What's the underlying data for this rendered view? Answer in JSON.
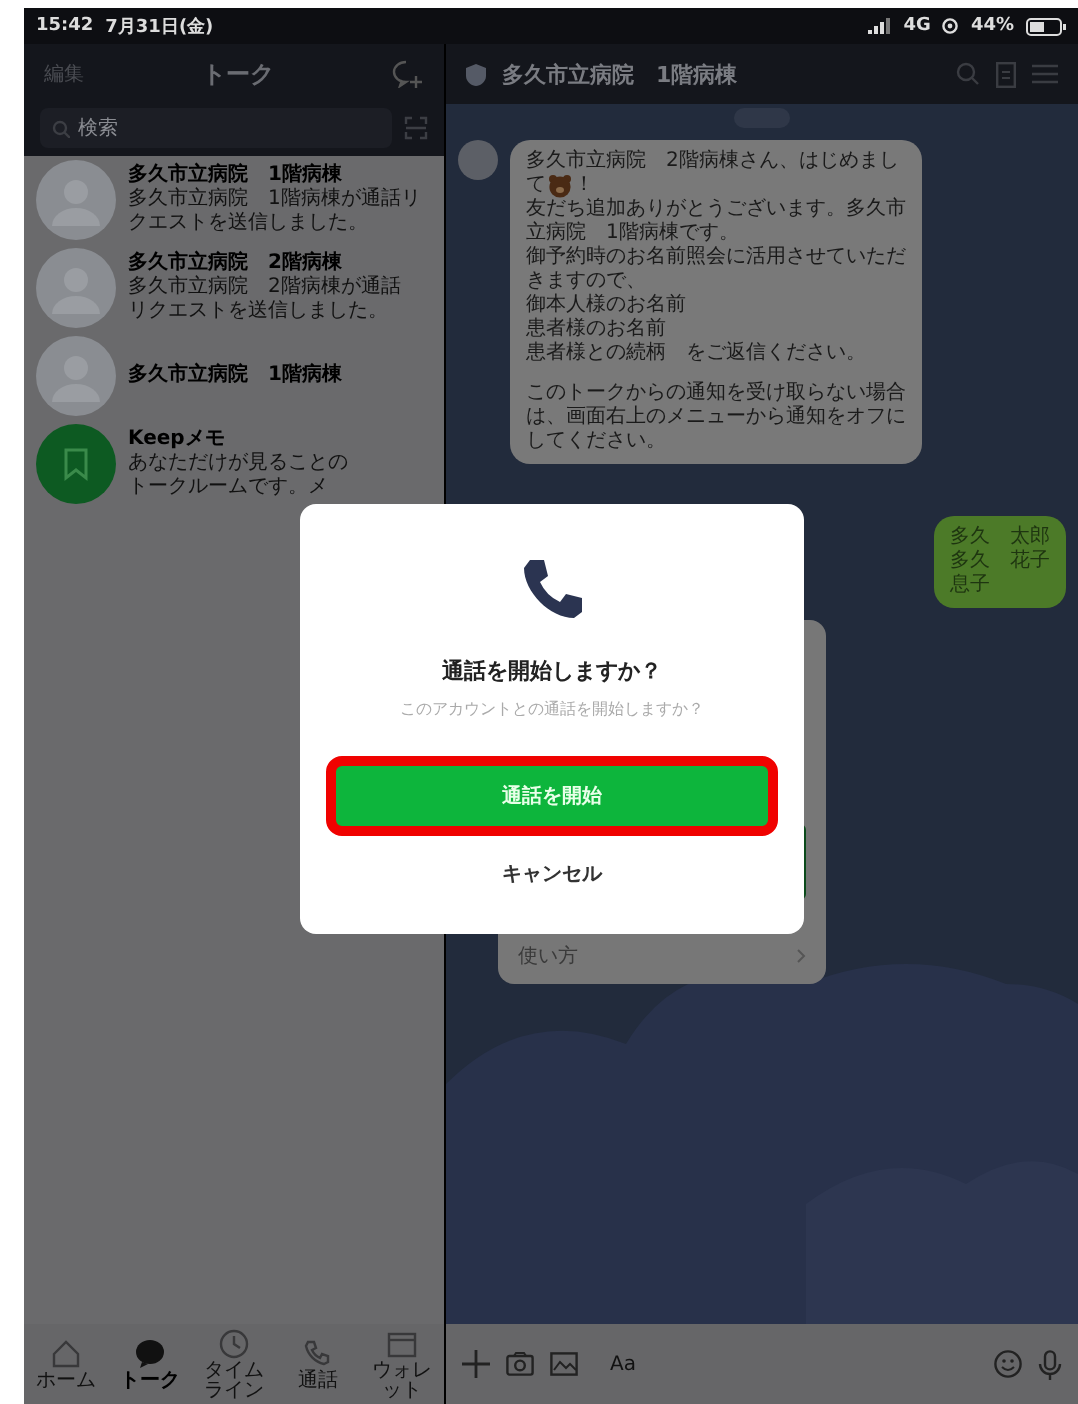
{
  "status_bar": {
    "time": "15:42",
    "date": "7月31日(金)",
    "network": "4G",
    "battery": "44%"
  },
  "sidebar": {
    "edit": "編集",
    "title": "トーク",
    "search_placeholder": "検索",
    "chats": [
      {
        "kind": "person",
        "name": "多久市立病院　1階病棟",
        "preview": [
          "多久市立病院　1階病棟が通話リ",
          "クエストを送信しました。"
        ]
      },
      {
        "kind": "person",
        "name": "多久市立病院　2階病棟",
        "preview": [
          "多久市立病院　2階病棟が通話",
          "リクエストを送信しました。"
        ]
      },
      {
        "kind": "person",
        "name": "多久市立病院　1階病棟"
      },
      {
        "kind": "keep",
        "name": "Keepメモ",
        "preview": [
          "あなただけが見ることの",
          "トークルームです。メ"
        ]
      }
    ]
  },
  "tabbar": [
    {
      "kind": "home",
      "label": "ホーム",
      "selected": false
    },
    {
      "kind": "talk",
      "label": "トーク",
      "selected": true
    },
    {
      "kind": "timeline",
      "label": "タイムライン",
      "selected": false
    },
    {
      "kind": "call",
      "label": "通話",
      "selected": false
    },
    {
      "kind": "wallet",
      "label": "ウォレット",
      "selected": false
    }
  ],
  "chat": {
    "title": "多久市立病院　1階病棟",
    "messages": [
      {
        "kind": "received",
        "paragraphs": [
          [
            "多久市立病院　2階病棟さん、はじめまし",
            [
              "て",
              {
                "kind": "emoji"
              },
              "！"
            ],
            "友だち追加ありがとうございます。多久市",
            "立病院　1階病棟です。",
            "御予約時のお名前照会に活用させていただ",
            "きますので、",
            "御本人様のお名前",
            "患者様のお名前",
            "患者様との続柄　をご返信ください。"
          ],
          [
            "このトークからの通知を受け取らない場合",
            "は、画面右上のメニューから通知をオフに",
            "してください。"
          ]
        ]
      },
      {
        "kind": "sent",
        "paragraphs": [
          [
            "多久　太郎",
            "多久　花子",
            "息子"
          ]
        ]
      },
      {
        "kind": "card",
        "link": "使い方"
      }
    ],
    "input_placeholder": "Aa"
  },
  "dialog": {
    "title": "通話を開始しますか？",
    "message": "このアカウントとの通話を開始しますか？",
    "confirm": "通話を開始",
    "confirm_highlighted": true,
    "cancel": "キャンセル"
  }
}
